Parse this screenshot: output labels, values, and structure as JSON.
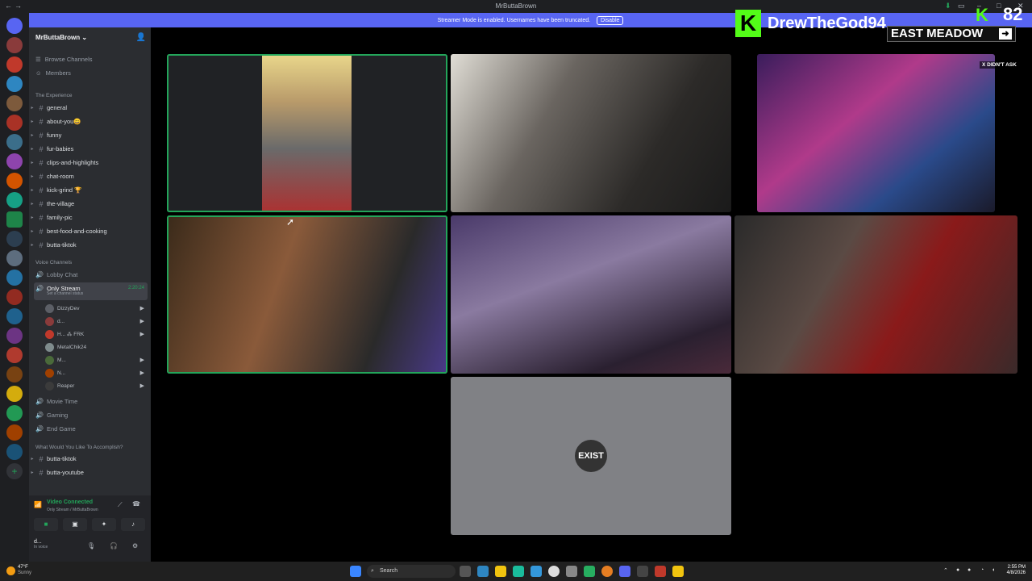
{
  "window": {
    "title": "MrButtaBrown"
  },
  "banner": {
    "text": "Streamer Mode is enabled. Usernames have been truncated.",
    "button": "Disable"
  },
  "sidebar": {
    "server_name": "MrButtaBrown",
    "nav": [
      "Browse Channels",
      "Members"
    ],
    "category1": "The Experience",
    "channels": [
      "general",
      "about-you😀",
      "funny",
      "fur-babies",
      "clips-and-highlights",
      "chat-room",
      "kick-grind 🏆",
      "the-village",
      "family-pic",
      "best-food-and-cooking",
      "butta-tiktok"
    ],
    "voice_category": "Voice Channels",
    "voice_channels": {
      "lobby": "Lobby Chat",
      "active": "Only Stream",
      "active_duration": "2:20:24",
      "active_status": "Set a channel status",
      "others": [
        "Movie Time",
        "Gaming",
        "End Game"
      ]
    },
    "members": [
      "DizzyDev",
      "d...",
      "H... ⁂ FRK",
      "MetalChik24",
      "M...",
      "N...",
      "Reaper"
    ],
    "category2": "What Would You Like To Accomplish?",
    "channels2": [
      "butta-tiktok",
      "butta-youtube"
    ]
  },
  "voice_panel": {
    "status": "Video Connected",
    "sub": "Only Stream / MrButtaBrown"
  },
  "user_panel": {
    "name": "d...",
    "status": "In voice"
  },
  "stage": {
    "tile_placeholder": "EXIST"
  },
  "overlay": {
    "name": "DrewTheGod94",
    "count": "82",
    "meadow": "EAST MEADOW",
    "didnt_ask": "X DIDN'T ASK",
    "k": "K"
  },
  "taskbar": {
    "temp": "47°F",
    "weather": "Sunny",
    "search": "Search",
    "time": "2:55 PM",
    "date": "4/8/2026"
  },
  "colors": {
    "accent": "#5865f2",
    "speaking": "#23a55a",
    "kick": "#53fc18"
  }
}
